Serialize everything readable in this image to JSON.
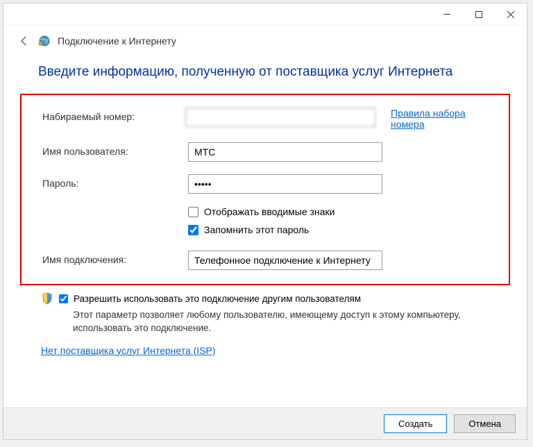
{
  "window": {
    "title": "Подключение к Интернету"
  },
  "heading": "Введите информацию, полученную от поставщика услуг Интернета",
  "form": {
    "dial_number_label": "Набираемый номер:",
    "dial_number_value": "",
    "dial_rules_link": "Правила набора номера",
    "username_label": "Имя пользователя:",
    "username_value": "МТС",
    "password_label": "Пароль:",
    "password_value": "•••••",
    "show_chars_label": "Отображать вводимые знаки",
    "show_chars_checked": false,
    "remember_pw_label": "Запомнить этот пароль",
    "remember_pw_checked": true,
    "connection_name_label": "Имя подключения:",
    "connection_name_value": "Телефонное подключение к Интернету"
  },
  "allow": {
    "label": "Разрешить использовать это подключение другим пользователям",
    "checked": true,
    "help": "Этот параметр позволяет любому пользователю, имеющему доступ к этому компьютеру, использовать это подключение."
  },
  "isp_link": "Нет поставщика услуг Интернета (ISP)",
  "buttons": {
    "create": "Создать",
    "cancel": "Отмена"
  }
}
